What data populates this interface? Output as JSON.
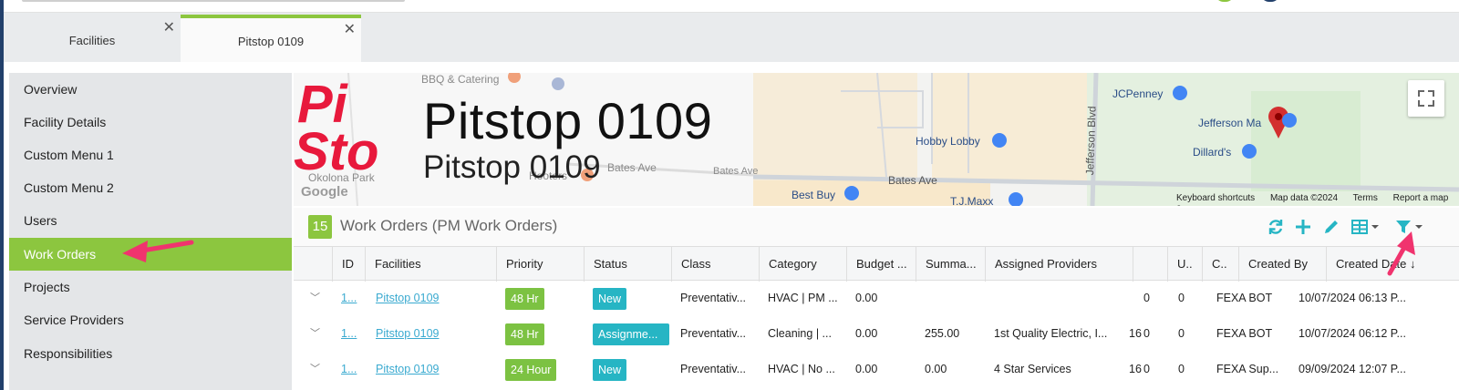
{
  "tabs": [
    {
      "label": "Facilities",
      "active": false
    },
    {
      "label": "Pitstop 0109",
      "active": true
    }
  ],
  "sidebar": {
    "items": [
      {
        "label": "Overview"
      },
      {
        "label": "Facility Details"
      },
      {
        "label": "Custom Menu 1"
      },
      {
        "label": "Custom Menu 2"
      },
      {
        "label": "Users"
      },
      {
        "label": "Work Orders",
        "active": true
      },
      {
        "label": "Projects"
      },
      {
        "label": "Service Providers"
      },
      {
        "label": "Responsibilities"
      }
    ]
  },
  "facility": {
    "logo_text": "PitSto",
    "title": "Pitstop 0109",
    "subtitle": "Pitstop 0109"
  },
  "map": {
    "labels": {
      "bbq": "BBQ & Catering",
      "jcpenney": "JCPenney",
      "jefferson_mall": "Jefferson Ma",
      "hobby_lobby": "Hobby Lobby",
      "dillards": "Dillard's",
      "bates_ave_1": "Bates Ave",
      "bates_ave_2": "Bates Ave",
      "bates_ave_3": "Bates Ave",
      "jefferson_blvd": "Jefferson Blvd",
      "best_buy": "Best Buy",
      "tjmaxx": "T.J.Maxx",
      "park": "Okolona Park",
      "hooters": "Hooters"
    },
    "google": "Google",
    "footer": [
      "Keyboard shortcuts",
      "Map data ©2024",
      "Terms",
      "Report a map e"
    ]
  },
  "work_orders": {
    "count": "15",
    "title": "Work Orders (PM Work Orders)",
    "columns": [
      "ID",
      "Facilities",
      "Priority",
      "Status",
      "Class",
      "Category",
      "Budget ...",
      "Summa...",
      "Assigned Providers",
      "",
      "U..",
      "C..",
      "Created By",
      "Created Date"
    ],
    "rows": [
      {
        "id": "1...",
        "facility": "Pitstop 0109",
        "priority": "48 Hr",
        "status": "New",
        "status_color": "#26b5c4",
        "class": "Preventativ...",
        "category": "HVAC | PM ...",
        "budget": "0.00",
        "summary": "",
        "providers": "",
        "extra": "",
        "u": "0",
        "c": "0",
        "created_by": "FEXA BOT",
        "created_date": "10/07/2024 06:13 P..."
      },
      {
        "id": "1...",
        "facility": "Pitstop 0109",
        "priority": "48 Hr",
        "status": "Assignme...",
        "status_color": "#26b5c4",
        "class": "Preventativ...",
        "category": "Cleaning | ...",
        "budget": "0.00",
        "summary": "255.00",
        "providers": "1st Quality Electric, I...",
        "extra": "16",
        "u": "0",
        "c": "0",
        "created_by": "FEXA BOT",
        "created_date": "10/07/2024 06:12 P..."
      },
      {
        "id": "1...",
        "facility": "Pitstop 0109",
        "priority": "24 Hour",
        "status": "New",
        "status_color": "#26b5c4",
        "class": "Preventativ...",
        "category": "HVAC | No ...",
        "budget": "0.00",
        "summary": "0.00",
        "providers": "4 Star Services",
        "extra": "16",
        "u": "0",
        "c": "0",
        "created_by": "FEXA Sup...",
        "created_date": "09/09/2024 12:07 P..."
      }
    ]
  },
  "colors": {
    "accent": "#8cc63f",
    "teal": "#26b5c4",
    "link": "#3aaad0",
    "annotation_arrow": "#f0336e"
  }
}
